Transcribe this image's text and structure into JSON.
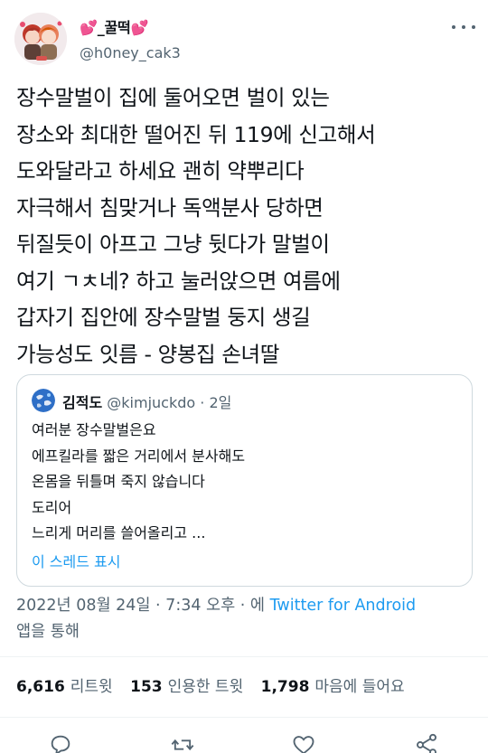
{
  "author": {
    "display_name": "💕_꿀떡💕",
    "handle": "@h0ney_cak3",
    "avatar_icon": "profile-avatar-illustration"
  },
  "tweet": {
    "lines": [
      "장수말벌이 집에 둘어오면 벌이 있는",
      "장소와 최대한 떨어진 뒤 119에 신고해서",
      "도와달라고 하세요 괜히 약뿌리다",
      "자극해서 침맞거나 독액분사 당하면",
      "뒤질듯이 아프고 그냥 뒷다가 말벌이",
      "여기 ㄱㅊ네? 하고 눌러앉으면 여름에",
      "갑자기 집안에 장수말벌 둥지 생길",
      "가능성도 잇름 - 양봉집 손녀딸"
    ]
  },
  "quote": {
    "name": "김적도",
    "handle": "@kimjuckdo",
    "separator": "·",
    "time": "2일",
    "lines": [
      "여러분 장수말벌은요",
      "에프킬라를 짧은 거리에서 분사해도",
      "온몸을 뒤틀며 죽지 않습니다",
      "도리어",
      "느리게 머리를 쓸어올리고 ..."
    ],
    "show_thread": "이 스레드 표시"
  },
  "meta": {
    "timestamp": "2022년 08월 24일 · 7:34 오후 · 에",
    "app": "Twitter for Android",
    "suffix": "앱을 통해"
  },
  "stats": {
    "retweets_count": "6,616",
    "retweets_label": "리트윗",
    "quotes_count": "153",
    "quotes_label": "인용한 트윗",
    "likes_count": "1,798",
    "likes_label": "마음에 들어요"
  },
  "colors": {
    "text": "#0f1419",
    "secondary": "#536471",
    "link": "#1d9bf0",
    "border": "#cfd9de"
  }
}
